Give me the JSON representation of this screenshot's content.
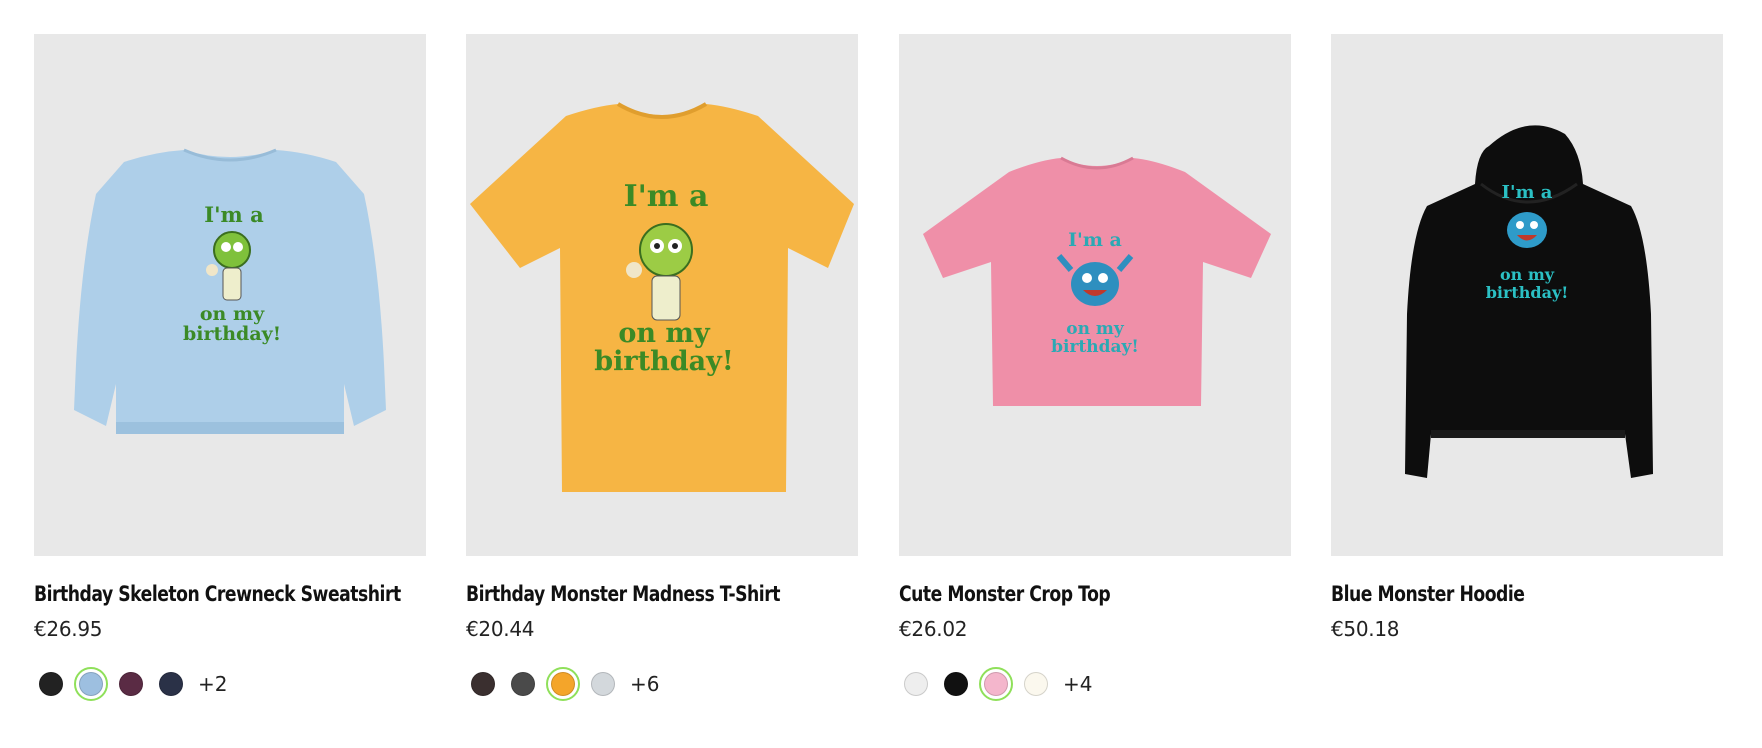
{
  "products": [
    {
      "name": "Birthday Skeleton Crewneck Sweatshirt",
      "price": "€26.95",
      "garment_color": "#aecfe9",
      "print": {
        "line1": "I'm a",
        "line2": "on my",
        "line3": "birthday!",
        "color": "#3b8a26"
      },
      "swatches": [
        {
          "color": "#222222",
          "selected": false
        },
        {
          "color": "#9dbfe0",
          "selected": true
        },
        {
          "color": "#5a2b44",
          "selected": false
        },
        {
          "color": "#2a3147",
          "selected": false
        }
      ],
      "more": "+2"
    },
    {
      "name": "Birthday Monster Madness T-Shirt",
      "price": "€20.44",
      "garment_color": "#f6b544",
      "print": {
        "line1": "I'm a",
        "line2": "on my",
        "line3": "birthday!",
        "color": "#3b8a26"
      },
      "swatches": [
        {
          "color": "#3a2f2f",
          "selected": false
        },
        {
          "color": "#4a4a4a",
          "selected": false
        },
        {
          "color": "#f4a52a",
          "selected": true
        },
        {
          "color": "#d3d8dc",
          "selected": false
        }
      ],
      "more": "+6"
    },
    {
      "name": "Cute Monster Crop Top",
      "price": "€26.02",
      "garment_color": "#ef8fa8",
      "print": {
        "line1": "I'm a",
        "line2": "on my",
        "line3": "birthday!",
        "color": "#2ba9b4"
      },
      "swatches": [
        {
          "color": "#eeeeee",
          "selected": false
        },
        {
          "color": "#111111",
          "selected": false
        },
        {
          "color": "#f4b6cc",
          "selected": true
        },
        {
          "color": "#fbf8ee",
          "selected": false
        }
      ],
      "more": "+4"
    },
    {
      "name": "Blue Monster Hoodie",
      "price": "€50.18",
      "garment_color": "#0d0d0d",
      "print": {
        "line1": "I'm a",
        "line2": "on my",
        "line3": "birthday!",
        "color": "#2bc0c4"
      },
      "swatches": [],
      "more": ""
    }
  ]
}
